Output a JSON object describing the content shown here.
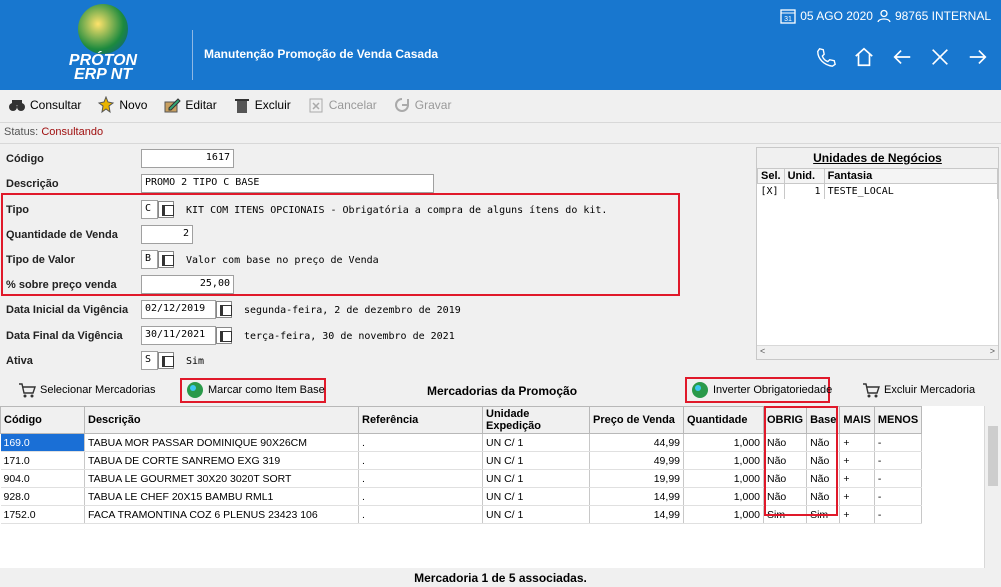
{
  "app": {
    "logo_line1": "PRÓTON",
    "logo_line2": "ERP NT",
    "screen_title": "Manutenção Promoção de Venda Casada",
    "date": "05 AGO 2020",
    "calendar_day": "31",
    "user": "98765 INTERNAL"
  },
  "toolbar": {
    "consultar": "Consultar",
    "novo": "Novo",
    "editar": "Editar",
    "excluir": "Excluir",
    "cancelar": "Cancelar",
    "gravar": "Gravar"
  },
  "status": {
    "label": "Status:",
    "value": "Consultando"
  },
  "form": {
    "codigo_label": "Código",
    "codigo": "1617",
    "descricao_label": "Descrição",
    "descricao": "PROMO 2 TIPO C BASE",
    "tipo_label": "Tipo",
    "tipo": "C",
    "tipo_desc": "KIT COM ITENS OPCIONAIS - Obrigatória a compra de alguns ítens do kit.",
    "qtd_label": "Quantidade de Venda",
    "qtd": "2",
    "tipo_valor_label": "Tipo de Valor",
    "tipo_valor": "B",
    "tipo_valor_desc": "Valor com base no preço de Venda",
    "pct_label": "% sobre preço venda",
    "pct": "25,00",
    "data_ini_label": "Data Inicial da Vigência",
    "data_ini": "02/12/2019",
    "data_ini_desc": "segunda-feira, 2 de dezembro de 2019",
    "data_fim_label": "Data Final da Vigência",
    "data_fim": "30/11/2021",
    "data_fim_desc": "terça-feira, 30 de novembro de 2021",
    "ativa_label": "Ativa",
    "ativa": "S",
    "ativa_desc": "Sim"
  },
  "unidades": {
    "title": "Unidades de Negócios",
    "cols": [
      "Sel.",
      "Unid.",
      "Fantasia"
    ],
    "rows": [
      {
        "sel": "[X]",
        "unid": "1",
        "fantasia": "TESTE_LOCAL"
      }
    ]
  },
  "actions": {
    "selecionar": "Selecionar Mercadorias",
    "marcar": "Marcar como Item Base",
    "title": "Mercadorias da Promoção",
    "inverter": "Inverter Obrigatoriedade",
    "excluir": "Excluir Mercadoria"
  },
  "grid": {
    "cols": [
      "Código",
      "Descrição",
      "Referência",
      "Unidade Expedição",
      "Preço de Venda",
      "Quantidade",
      "OBRIG",
      "Base",
      "MAIS",
      "MENOS"
    ],
    "rows": [
      {
        "codigo": "169.0",
        "descricao": "TABUA MOR PASSAR DOMINIQUE 90X26CM",
        "referencia": ".",
        "unidade": "UN C/ 1",
        "preco": "44,99",
        "quantidade": "1,000",
        "obrig": "Não",
        "base": "Não",
        "mais": "+",
        "menos": "-"
      },
      {
        "codigo": "171.0",
        "descricao": "TABUA DE CORTE SANREMO EXG 319",
        "referencia": ".",
        "unidade": "UN C/ 1",
        "preco": "49,99",
        "quantidade": "1,000",
        "obrig": "Não",
        "base": "Não",
        "mais": "+",
        "menos": "-"
      },
      {
        "codigo": "904.0",
        "descricao": "TABUA LE GOURMET 30X20 3020T SORT",
        "referencia": ".",
        "unidade": "UN C/ 1",
        "preco": "19,99",
        "quantidade": "1,000",
        "obrig": "Não",
        "base": "Não",
        "mais": "+",
        "menos": "-"
      },
      {
        "codigo": "928.0",
        "descricao": "TABUA LE CHEF 20X15 BAMBU RML1",
        "referencia": ".",
        "unidade": "UN C/ 1",
        "preco": "14,99",
        "quantidade": "1,000",
        "obrig": "Não",
        "base": "Não",
        "mais": "+",
        "menos": "-"
      },
      {
        "codigo": "1752.0",
        "descricao": "FACA TRAMONTINA COZ 6 PLENUS 23423 106",
        "referencia": ".",
        "unidade": "UN C/ 1",
        "preco": "14,99",
        "quantidade": "1,000",
        "obrig": "Sim",
        "base": "Sim",
        "mais": "+",
        "menos": "-"
      }
    ]
  },
  "footer": {
    "text": "Mercadoria 1 de 5 associadas."
  },
  "colors": {
    "header_bg": "#1877cf",
    "highlight": "#e0192a",
    "status_value": "#a01010",
    "selection": "#1a6fd6"
  }
}
